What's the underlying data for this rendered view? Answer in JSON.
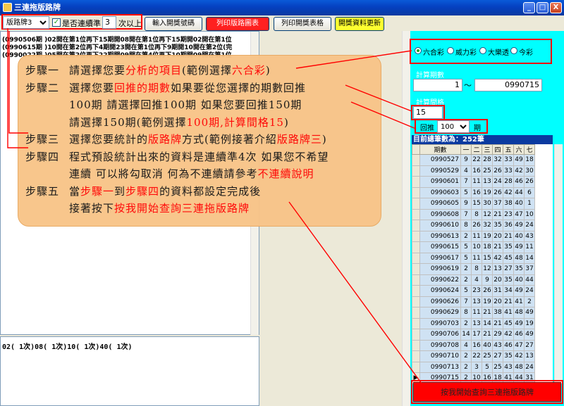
{
  "window": {
    "title": "三連拖版路牌",
    "min": "_",
    "max": "□",
    "close": "X"
  },
  "toolbar": {
    "board_select": "版路牌3",
    "consecutive_label": "是否連續準",
    "consecutive_value": "3",
    "times_above": "次以上",
    "input_btn": "輸入開獎號碼",
    "print_chart_btn": "列印版路圖表",
    "print_table_btn": "列印開獎表格",
    "update_btn": "開獎資料更新"
  },
  "results": [
    "(0990506期 )02開在第1位再下15期開08開在第1位再下15期開02開在第1位",
    "(0990615期 )10開在第2位再下4期開23開在第1位再下9期開10開在第2位(完",
    "(0990022期 )05開在第2位再下22期開09開在第4位再下10期開09開在第1位"
  ],
  "bottom_text": "02(  1次)08(  1次)10(  1次)40(  1次)",
  "radios": [
    "六合彩",
    "威力彩",
    "大樂透",
    "今彩"
  ],
  "period": {
    "label": "計算期數",
    "from": "1",
    "sep": "～",
    "to": "0990715"
  },
  "interval": {
    "label": "計算間格",
    "value": "15"
  },
  "back": {
    "label": "回推",
    "value": "100",
    "unit": "期"
  },
  "total": "目前總筆數為：252筆",
  "grid": {
    "headers": [
      "期數",
      "一",
      "二",
      "三",
      "四",
      "五",
      "六",
      "七"
    ],
    "rows": [
      [
        "0990527",
        "9",
        "22",
        "28",
        "32",
        "33",
        "49",
        "18"
      ],
      [
        "0990529",
        "4",
        "16",
        "25",
        "26",
        "33",
        "42",
        "30"
      ],
      [
        "0990601",
        "7",
        "11",
        "13",
        "24",
        "28",
        "46",
        "26"
      ],
      [
        "0990603",
        "5",
        "16",
        "19",
        "26",
        "42",
        "44",
        "6"
      ],
      [
        "0990605",
        "9",
        "15",
        "30",
        "37",
        "38",
        "40",
        "1"
      ],
      [
        "0990608",
        "7",
        "8",
        "12",
        "21",
        "23",
        "47",
        "10"
      ],
      [
        "0990610",
        "8",
        "26",
        "32",
        "35",
        "36",
        "49",
        "24"
      ],
      [
        "0990613",
        "2",
        "11",
        "19",
        "20",
        "21",
        "40",
        "43"
      ],
      [
        "0990615",
        "5",
        "10",
        "18",
        "21",
        "35",
        "49",
        "11"
      ],
      [
        "0990617",
        "5",
        "11",
        "15",
        "42",
        "45",
        "48",
        "14"
      ],
      [
        "0990619",
        "2",
        "8",
        "12",
        "13",
        "27",
        "35",
        "37"
      ],
      [
        "0990622",
        "2",
        "4",
        "9",
        "20",
        "35",
        "40",
        "44"
      ],
      [
        "0990624",
        "5",
        "23",
        "26",
        "31",
        "34",
        "49",
        "24"
      ],
      [
        "0990626",
        "7",
        "13",
        "19",
        "20",
        "21",
        "41",
        "2"
      ],
      [
        "0990629",
        "8",
        "11",
        "21",
        "38",
        "41",
        "48",
        "49"
      ],
      [
        "0990703",
        "2",
        "13",
        "14",
        "21",
        "45",
        "49",
        "19"
      ],
      [
        "0990706",
        "14",
        "17",
        "21",
        "29",
        "42",
        "46",
        "49"
      ],
      [
        "0990708",
        "4",
        "16",
        "40",
        "43",
        "46",
        "47",
        "27"
      ],
      [
        "0990710",
        "2",
        "22",
        "25",
        "27",
        "35",
        "42",
        "13"
      ],
      [
        "0990713",
        "2",
        "3",
        "5",
        "25",
        "43",
        "48",
        "24"
      ],
      [
        "0990715",
        "2",
        "10",
        "16",
        "18",
        "41",
        "44",
        "31"
      ]
    ]
  },
  "start_btn": "按我開始查詢三連拖版路牌",
  "steps": [
    {
      "head": "步驟一",
      "parts": [
        [
          "請選擇您要",
          0
        ],
        [
          "分析的項目",
          1
        ],
        [
          "(範例選擇",
          0
        ],
        [
          "六合彩",
          1
        ],
        [
          ")",
          0
        ]
      ]
    },
    {
      "head": "步驟二",
      "parts": [
        [
          "選擇您要",
          0
        ],
        [
          "回推的期數",
          1
        ],
        [
          "如果要從您選擇的期數回推",
          0
        ]
      ]
    },
    {
      "head": "",
      "parts": [
        [
          "100期  請選擇回推100期  如果您要回推150期",
          0
        ]
      ]
    },
    {
      "head": "",
      "parts": [
        [
          "請選擇150期(範例選擇",
          0
        ],
        [
          "100期,計算間格15",
          1
        ],
        [
          ")",
          0
        ]
      ]
    },
    {
      "head": "步驟三",
      "parts": [
        [
          "選擇您要統計的",
          0
        ],
        [
          "版路牌",
          1
        ],
        [
          "方式(範例接著介紹",
          0
        ],
        [
          "版路牌三",
          1
        ],
        [
          ")",
          0
        ]
      ]
    },
    {
      "head": "步驟四",
      "parts": [
        [
          "程式預設統計出來的資料是連續準4次  如果您不希望",
          0
        ]
      ]
    },
    {
      "head": "",
      "parts": [
        [
          "連續  可以將勾取消   何為不連續請參考",
          0
        ],
        [
          "不連續說明",
          1
        ]
      ]
    },
    {
      "head": "步驟五",
      "parts": [
        [
          "當",
          0
        ],
        [
          "步驟一",
          1
        ],
        [
          "到",
          0
        ],
        [
          "步驟四",
          1
        ],
        [
          "的資料都設定完成後",
          0
        ]
      ]
    },
    {
      "head": "",
      "parts": [
        [
          "接著按下",
          0
        ],
        [
          "按我開始查詢三連拖版路牌",
          1
        ]
      ]
    }
  ]
}
